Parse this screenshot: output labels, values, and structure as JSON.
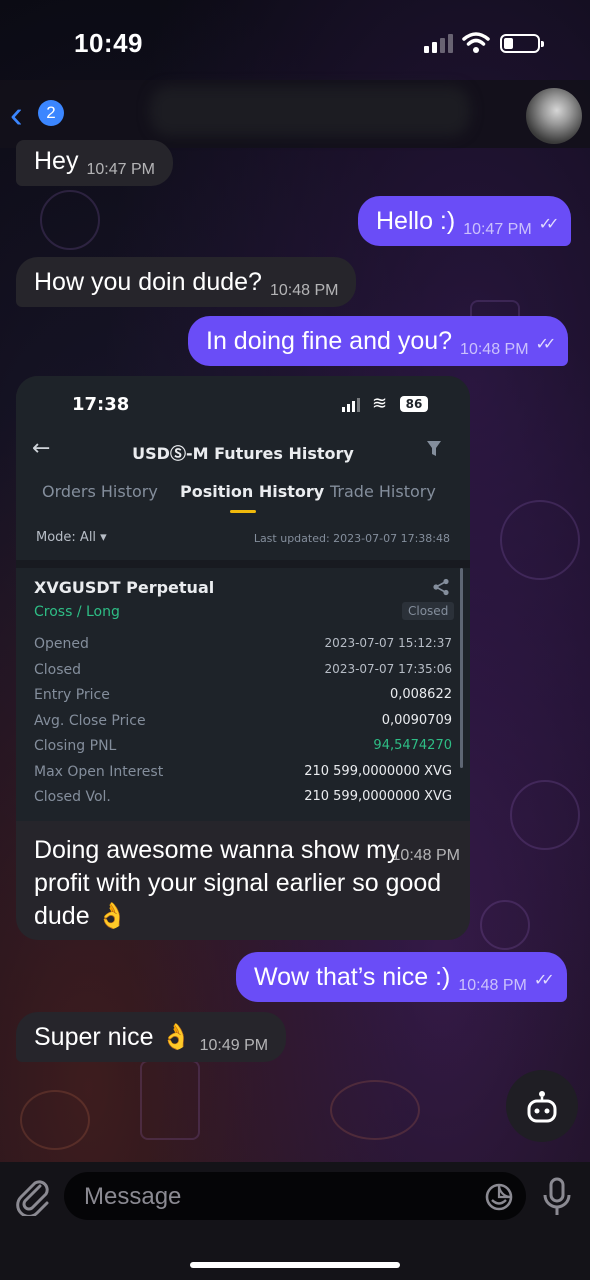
{
  "status_bar": {
    "time": "10:49"
  },
  "header": {
    "back_count": "2"
  },
  "messages": [
    {
      "dir": "in",
      "text": "Hey",
      "time": "10:47 PM"
    },
    {
      "dir": "out",
      "text": "Hello :)",
      "time": "10:47 PM"
    },
    {
      "dir": "in",
      "text": "How you doin dude?",
      "time": "10:48 PM"
    },
    {
      "dir": "out",
      "text": "In doing fine and you?",
      "time": "10:48 PM"
    },
    {
      "dir": "out",
      "text": "Wow that’s nice :)",
      "time": "10:48 PM"
    },
    {
      "dir": "in",
      "text": "Super nice 👌",
      "time": "10:49 PM"
    }
  ],
  "screenshot": {
    "time": "17:38",
    "battery": "86",
    "title": "USDⓈ-M Futures History",
    "tabs": [
      "Orders History",
      "Position History",
      "Trade History"
    ],
    "active_tab": "Position History",
    "mode": "Mode: All ▾",
    "updated": "Last updated: 2023-07-07 17:38:48",
    "symbol": "XVGUSDT Perpetual",
    "side": "Cross / Long",
    "status": "Closed",
    "rows": [
      {
        "label": "Opened",
        "value": "2023-07-07 15:12:37"
      },
      {
        "label": "Closed",
        "value": "2023-07-07 17:35:06"
      },
      {
        "label": "Entry Price",
        "value": "0,008622"
      },
      {
        "label": "Avg. Close Price",
        "value": "0,0090709"
      },
      {
        "label": "Closing PNL",
        "value": "94,5474270"
      },
      {
        "label": "Max Open Interest",
        "value": "210 599,0000000 XVG"
      },
      {
        "label": "Closed Vol.",
        "value": "210 599,0000000 XVG"
      }
    ]
  },
  "screenshot_caption": {
    "text": "Doing awesome wanna show my profit with your signal earlier so good dude 👌",
    "time": "10:48 PM"
  },
  "input": {
    "placeholder": "Message"
  },
  "colors": {
    "outgoing": "#6a4df7",
    "incoming": "#26252b",
    "accent": "#3b86ff",
    "pnl_green": "#2ebd85",
    "binance_yellow": "#f0b90b"
  }
}
